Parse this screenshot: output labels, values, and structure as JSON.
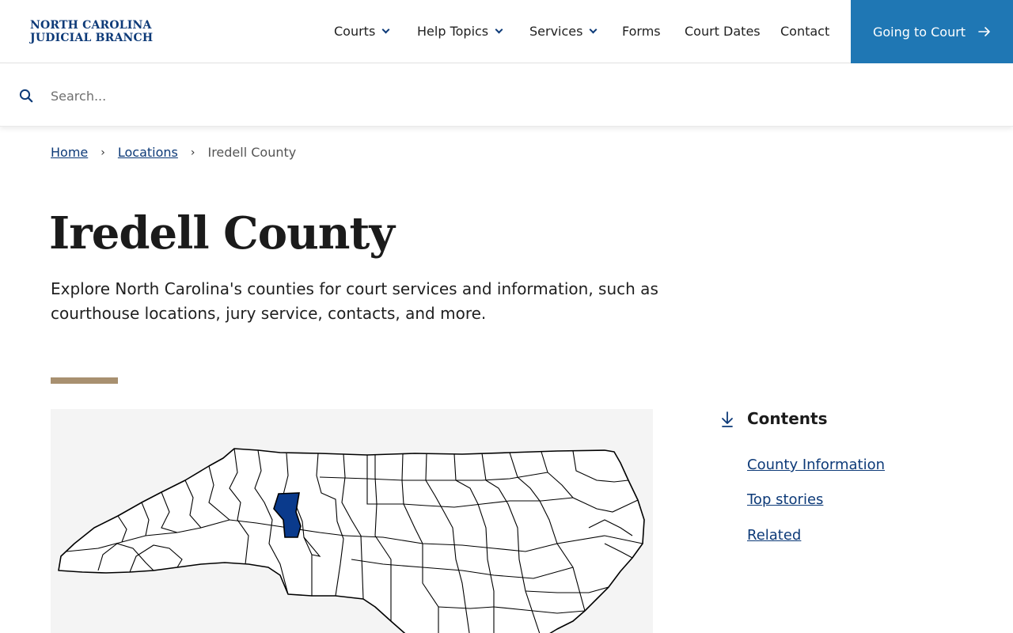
{
  "header": {
    "logo_line1": "NORTH CAROLINA",
    "logo_line2": "JUDICIAL BRANCH",
    "nav": [
      {
        "label": "Courts",
        "dropdown": true
      },
      {
        "label": "Help Topics",
        "dropdown": true
      },
      {
        "label": "Services",
        "dropdown": true
      },
      {
        "label": "Forms",
        "dropdown": false
      },
      {
        "label": "Court Dates",
        "dropdown": false
      },
      {
        "label": "Contact",
        "dropdown": false
      }
    ],
    "cta_label": "Going to Court",
    "cta_icon": "arrow-right-icon"
  },
  "search": {
    "placeholder": "Search...",
    "value": ""
  },
  "breadcrumb": {
    "home": "Home",
    "locations": "Locations",
    "current": "Iredell County"
  },
  "page": {
    "title": "Iredell County",
    "intro": "Explore North Carolina's counties for court services and information, such as courthouse locations, jury service, contacts, and more."
  },
  "map": {
    "highlight_color": "#0a3a8c",
    "highlighted_county": "Iredell"
  },
  "contents": {
    "title": "Contents",
    "links": [
      "County Information",
      "Top stories",
      "Related"
    ]
  },
  "colors": {
    "brand_blue": "#0d3a78",
    "cta_blue": "#1f77b4",
    "accent_tan": "#a89070"
  }
}
